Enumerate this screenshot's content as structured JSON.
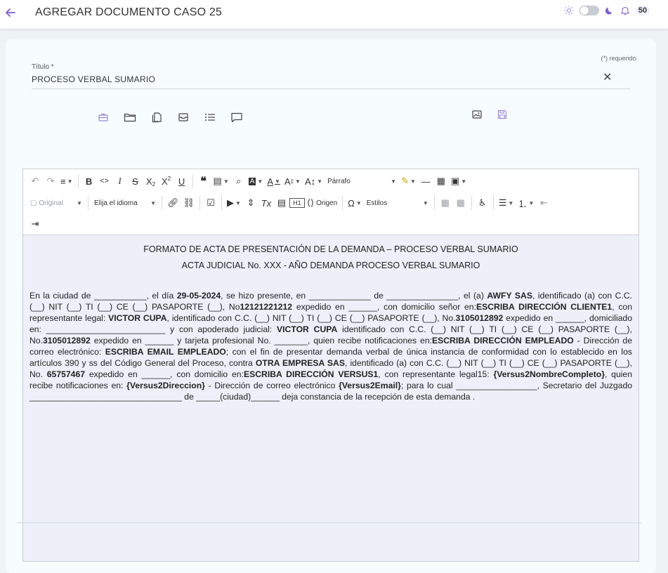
{
  "header": {
    "title": "AGREGAR DOCUMENTO CASO 25",
    "notification_count": "50"
  },
  "form": {
    "required_note": "(*) requerido.",
    "title_label": "Título *",
    "title_value": "PROCESO VERBAL SUMARIO"
  },
  "toolbar": {
    "paragraph_select": "Párrafo",
    "original_select": "Original",
    "language_select": "Elija el idioma",
    "source_label": "Origen",
    "styles_select": "Estilos"
  },
  "document": {
    "heading1": "FORMATO DE ACTA DE PRESENTACIÓN DE LA DEMANDA – PROCESO VERBAL SUMARIO",
    "heading2": "ACTA JUDICIAL No. XXX - AÑO DEMANDA PROCESO VERBAL SUMARIO",
    "segments": [
      {
        "t": "En la ciudad de ___________, el día ",
        "b": false
      },
      {
        "t": "29-05-2024",
        "b": true
      },
      {
        "t": ", se hizo presente, en _____________ de _______________, el (a) ",
        "b": false
      },
      {
        "t": "AWFY SAS",
        "b": true
      },
      {
        "t": ", identificado (a) con C.C. (__) NIT (__)  TI (__)  CE (__) PASAPORTE (__), No",
        "b": false
      },
      {
        "t": "12121221212",
        "b": true
      },
      {
        "t": " expedido en ______, con domicilio señor en:",
        "b": false
      },
      {
        "t": "ESCRIBA DIRECCIÓN CLIENTE1",
        "b": true
      },
      {
        "t": ", con representante legal: ",
        "b": false
      },
      {
        "t": "VICTOR CUPA",
        "b": true
      },
      {
        "t": ", identificado con C.C. (__) NIT (__)  TI (__)  CE (__) PASAPORTE (__), No.",
        "b": false
      },
      {
        "t": "3105012892",
        "b": true
      },
      {
        "t": " expedido en ______, domiciliado en: _________________________ y con apoderado judicial: ",
        "b": false
      },
      {
        "t": "VICTOR CUPA",
        "b": true
      },
      {
        "t": " identificado con C.C. (__) NIT (__)  TI (__)  CE (__) PASAPORTE (__), No.",
        "b": false
      },
      {
        "t": "3105012892",
        "b": true
      },
      {
        "t": " expedido en ______  y tarjeta profesional No. _______, quien recibe notificaciones en:",
        "b": false
      },
      {
        "t": "ESCRIBA DIRECCIÓN EMPLEADO",
        "b": true
      },
      {
        "t": " - Dirección de correo electrónico: ",
        "b": false
      },
      {
        "t": "ESCRIBA EMAIL EMPLEADO",
        "b": true
      },
      {
        "t": "; con el fin de presentar demanda verbal de única instancia de conformidad con lo establecido en los artículos 390 y ss del Código General del Proceso, contra ",
        "b": false
      },
      {
        "t": "OTRA EMPRESA SAS",
        "b": true
      },
      {
        "t": ", identificado (a) con C.C. (__) NIT (__)  TI (__)  CE (__) PASAPORTE (__), No. ",
        "b": false
      },
      {
        "t": "65757467",
        "b": true
      },
      {
        "t": " expedido en ______, con domicilio en:",
        "b": false
      },
      {
        "t": "ESCRIBA DIRECCIÓN VERSUS1",
        "b": true
      },
      {
        "t": ", con representante legal15: ",
        "b": false
      },
      {
        "t": "{Versus2NombreCompleto}",
        "b": true
      },
      {
        "t": ", quien recibe notificaciones en: ",
        "b": false
      },
      {
        "t": "{Versus2Direccion}",
        "b": true
      },
      {
        "t": " - Dirección de correo electrónico ",
        "b": false
      },
      {
        "t": "{Versus2Email}",
        "b": true
      },
      {
        "t": "; para lo cual _________________, Secretario del Juzgado ________________________________ de _____(ciudad)______ deja constancia de la recepción de esta demanda .",
        "b": false
      }
    ]
  },
  "colors": {
    "accent": "#7c5cd6",
    "accent_light": "#9b87e0",
    "content_bg": "#edf0f8"
  }
}
